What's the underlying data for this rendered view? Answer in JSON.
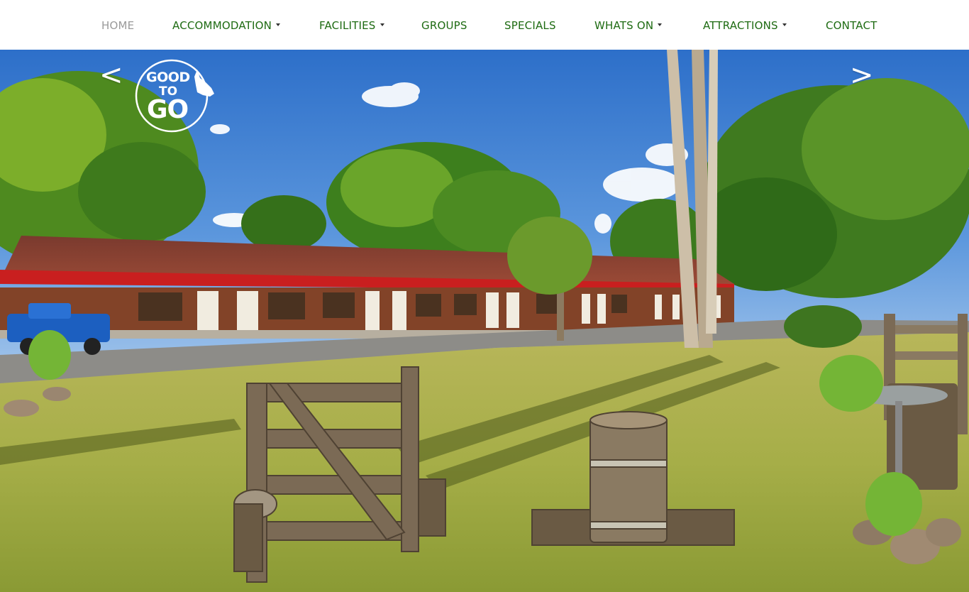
{
  "nav": {
    "items": [
      {
        "label": "HOME",
        "active": true,
        "has_dropdown": false
      },
      {
        "label": "ACCOMMODATION",
        "active": false,
        "has_dropdown": true
      },
      {
        "label": "FACILITIES",
        "active": false,
        "has_dropdown": true
      },
      {
        "label": "GROUPS",
        "active": false,
        "has_dropdown": false
      },
      {
        "label": "SPECIALS",
        "active": false,
        "has_dropdown": false
      },
      {
        "label": "WHATS ON",
        "active": false,
        "has_dropdown": true
      },
      {
        "label": "ATTRACTIONS",
        "active": false,
        "has_dropdown": true
      },
      {
        "label": "CONTACT",
        "active": false,
        "has_dropdown": false
      }
    ]
  },
  "slider": {
    "prev_label": "<",
    "next_label": ">"
  },
  "logo": {
    "line1": "GOOD",
    "line2": "TO",
    "line3": "GO"
  },
  "colors": {
    "nav_text": "#1e6b12",
    "nav_active": "#9a9a9a",
    "sky": "#3f7fd1",
    "grass": "#a8b84a",
    "roof": "#8c3b2b",
    "trim": "#c91f1f"
  },
  "icons": {
    "dropdown": "caret-down-icon",
    "logo_shape": "queensland-map-icon"
  }
}
